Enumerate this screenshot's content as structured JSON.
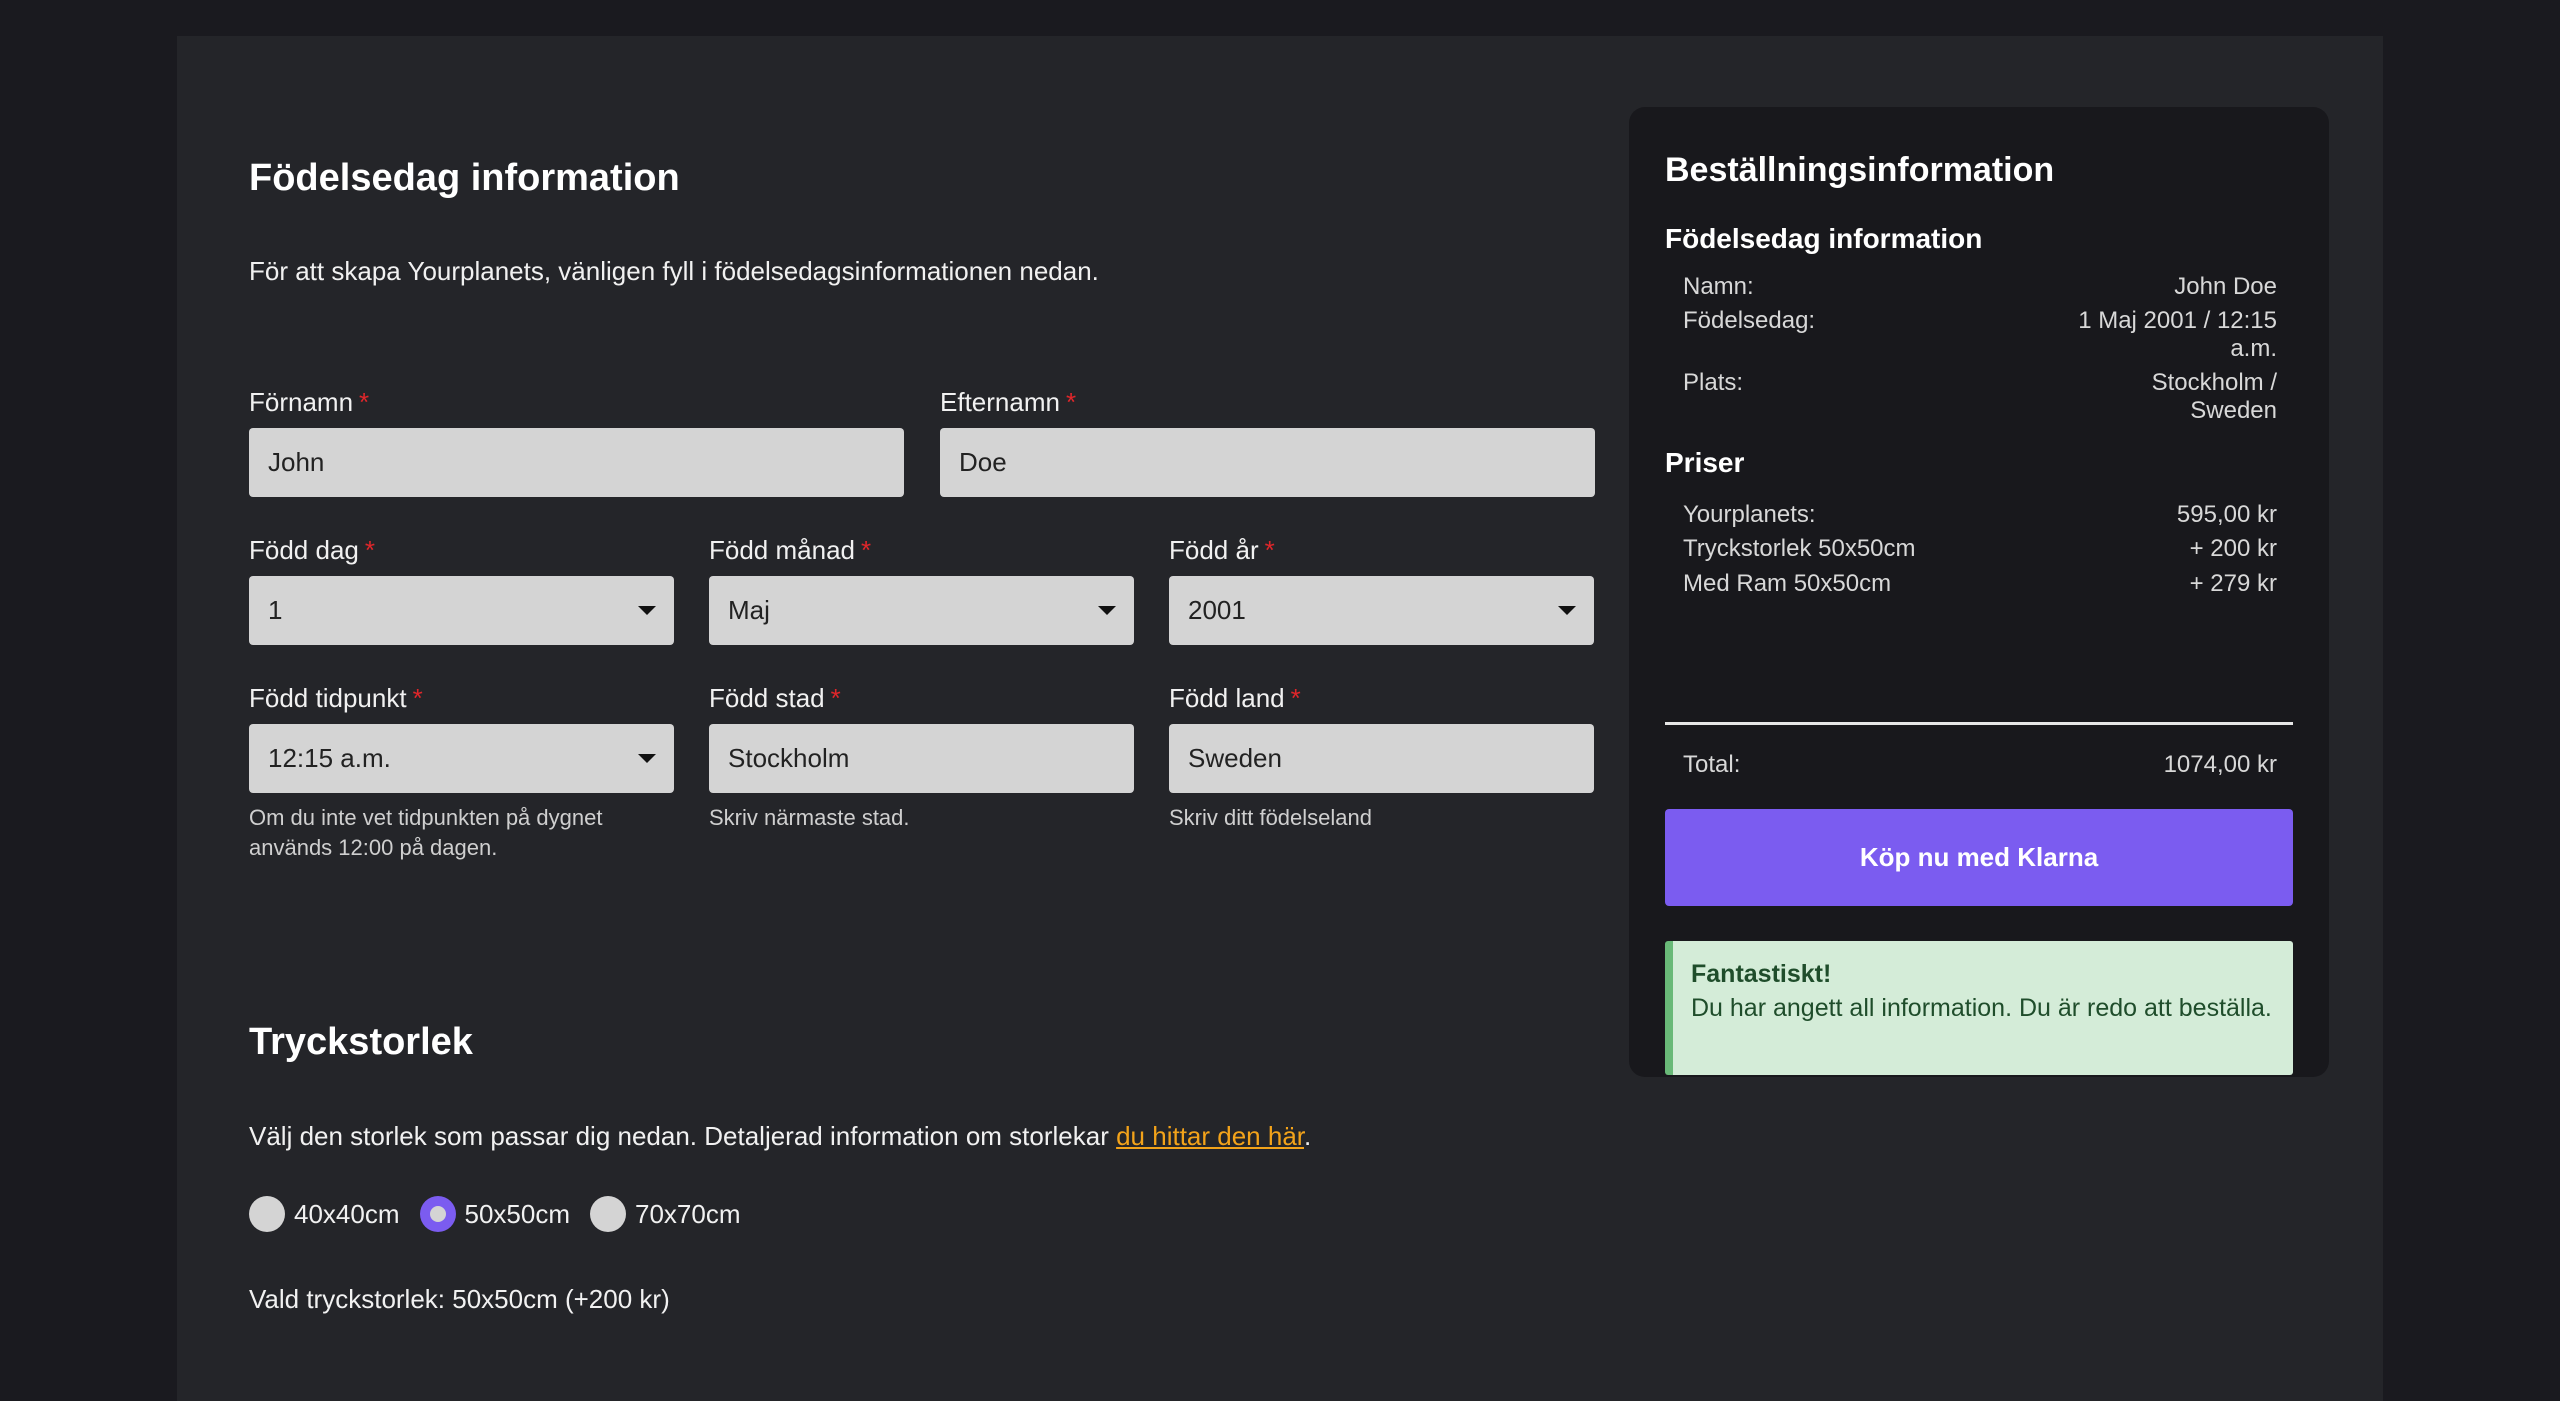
{
  "birth_section": {
    "title": "Födelsedag information",
    "intro": "För att skapa Yourplanets, vänligen fyll i födelsedagsinformationen nedan."
  },
  "fields": {
    "first_name": {
      "label": "Förnamn",
      "value": "John"
    },
    "last_name": {
      "label": "Efternamn",
      "value": "Doe"
    },
    "birth_day": {
      "label": "Född dag",
      "value": "1"
    },
    "birth_month": {
      "label": "Född månad",
      "value": "Maj"
    },
    "birth_year": {
      "label": "Född år",
      "value": "2001"
    },
    "birth_time": {
      "label": "Född tidpunkt",
      "value": "12:15 a.m.",
      "hint": "Om du inte vet tidpunkten på dygnet används 12:00 på dagen."
    },
    "birth_city": {
      "label": "Född stad",
      "value": "Stockholm",
      "hint": "Skriv närmaste stad."
    },
    "birth_country": {
      "label": "Född land",
      "value": "Sweden",
      "hint": "Skriv ditt födelseland"
    }
  },
  "required_mark": "*",
  "print_section": {
    "title": "Tryckstorlek",
    "intro_before_link": "Välj den storlek som passar dig nedan. Detaljerad information om storlekar ",
    "link_text": "du hittar den här",
    "intro_after_link": ".",
    "options": [
      {
        "label": "40x40cm",
        "selected": false
      },
      {
        "label": "50x50cm",
        "selected": true
      },
      {
        "label": "70x70cm",
        "selected": false
      }
    ],
    "selected_text": "Vald tryckstorlek: 50x50cm (+200 kr)"
  },
  "summary": {
    "title": "Beställningsinformation",
    "birth_heading": "Födelsedag information",
    "name_label": "Namn:",
    "name_value": "John Doe",
    "birthday_label": "Födelsedag:",
    "birthday_value": "1 Maj 2001 / 12:15 a.m.",
    "place_label": "Plats:",
    "place_value": "Stockholm / Sweden",
    "prices_heading": "Priser",
    "price_items": [
      {
        "label": "Yourplanets:",
        "value": "595,00 kr"
      },
      {
        "label": "Tryckstorlek 50x50cm",
        "value": "+ 200 kr"
      },
      {
        "label": "Med Ram 50x50cm",
        "value": "+ 279 kr"
      }
    ],
    "total_label": "Total:",
    "total_value": "1074,00 kr",
    "buy_label": "Köp nu med Klarna",
    "alert_title": "Fantastiskt!",
    "alert_text": "Du har angett all information. Du är redo att beställa."
  },
  "colors": {
    "accent": "#7b5cf0",
    "link": "#f3a31a",
    "required": "#e0262a",
    "success_bg": "#d4ecd8",
    "success_border": "#69b978"
  }
}
